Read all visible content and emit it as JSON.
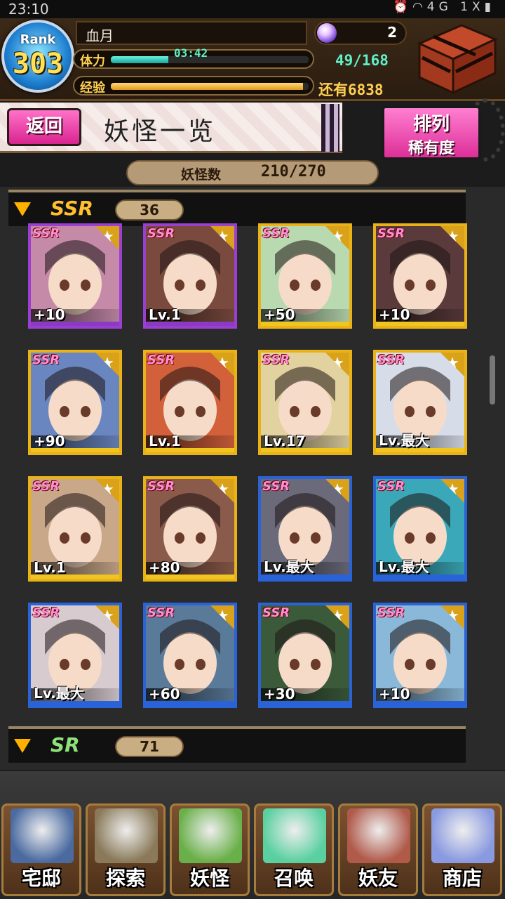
{
  "status_bar": {
    "time": "23:10",
    "icons": [
      "alarm-icon",
      "wifi-icon",
      "signal-4g-icon",
      "battery-icon"
    ],
    "network_text": "4G 1X"
  },
  "player": {
    "rank_label": "Rank",
    "rank_value": "303",
    "name": "血月",
    "stamina_label": "体力",
    "stamina_timer": "03:42",
    "stamina_value": "49/168",
    "stamina_fraction": 0.29,
    "exp_label": "经验",
    "exp_remaining": "还有6838",
    "exp_fraction": 0.97,
    "gems": "2"
  },
  "title_bar": {
    "back_label": "返回",
    "title": "妖怪一览",
    "sort_line1": "排列",
    "sort_line2": "稀有度"
  },
  "counter": {
    "label": "妖怪数",
    "value": "210/270"
  },
  "sections": [
    {
      "rarity": "SSR",
      "count": "36",
      "color": "#ffbf2e"
    },
    {
      "rarity": "SR",
      "count": "71",
      "color": "#8fe27a"
    }
  ],
  "cards": [
    {
      "tag": "SSR",
      "level": "+10",
      "frame": "purple",
      "bg": "#c48aa8"
    },
    {
      "tag": "SSR",
      "level": "Lv.1",
      "frame": "purple",
      "bg": "#7a4a3e"
    },
    {
      "tag": "SSR",
      "level": "+50",
      "frame": "gold",
      "bg": "#b9d9b0"
    },
    {
      "tag": "SSR",
      "level": "+10",
      "frame": "gold",
      "bg": "#5a3a3a"
    },
    {
      "tag": "SSR",
      "level": "+90",
      "frame": "gold",
      "bg": "#6a86c0"
    },
    {
      "tag": "SSR",
      "level": "Lv.1",
      "frame": "gold",
      "bg": "#d2603a"
    },
    {
      "tag": "SSR",
      "level": "Lv.17",
      "frame": "gold",
      "bg": "#e2d2a0"
    },
    {
      "tag": "SSR",
      "level": "Lv.最大",
      "frame": "gold",
      "bg": "#d7dde8"
    },
    {
      "tag": "SSR",
      "level": "Lv.1",
      "frame": "gold",
      "bg": "#c9a88a"
    },
    {
      "tag": "SSR",
      "level": "+80",
      "frame": "gold",
      "bg": "#8a5a4a"
    },
    {
      "tag": "SSR",
      "level": "Lv.最大",
      "frame": "blue",
      "bg": "#6a6a7a"
    },
    {
      "tag": "SSR",
      "level": "Lv.最大",
      "frame": "blue",
      "bg": "#3aa8b8"
    },
    {
      "tag": "SSR",
      "level": "Lv.最大",
      "frame": "blue",
      "bg": "#d8cbd0"
    },
    {
      "tag": "SSR",
      "level": "+60",
      "frame": "blue",
      "bg": "#5a7a9a"
    },
    {
      "tag": "SSR",
      "level": "+30",
      "frame": "blue",
      "bg": "#3a5a3a"
    },
    {
      "tag": "SSR",
      "level": "+10",
      "frame": "blue",
      "bg": "#8ab8d8"
    }
  ],
  "nav": [
    {
      "label": "宅邸",
      "icon": "mansion-icon",
      "color": "#4a6aa0"
    },
    {
      "label": "探索",
      "icon": "magnifier-map-icon",
      "color": "#8a7a5a"
    },
    {
      "label": "妖怪",
      "icon": "scroll-icon",
      "color": "#6ab04a"
    },
    {
      "label": "召唤",
      "icon": "pentagram-icon",
      "color": "#5ad0a0"
    },
    {
      "label": "妖友",
      "icon": "catgirl-friend-icon",
      "color": "#b05a4a"
    },
    {
      "label": "商店",
      "icon": "crystal-orb-icon",
      "color": "#8a9ae0"
    }
  ]
}
